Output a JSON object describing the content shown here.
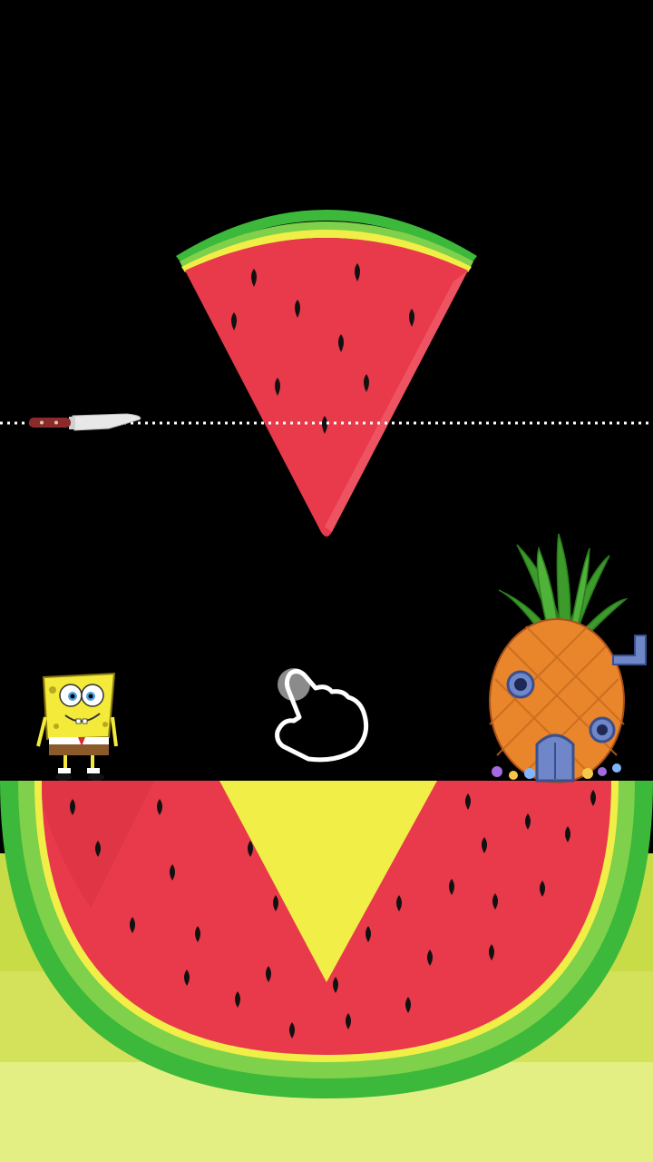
{
  "game": {
    "title": "",
    "objective_label": "",
    "colors": {
      "background": "#000000",
      "melon_flesh": "#e83a4b",
      "melon_flesh_highlight": "#ef5a66",
      "melon_rind_outer": "#3cb83a",
      "melon_rind_mid": "#7fd04a",
      "melon_rind_inner": "#f1ef47",
      "melon_seed": "#111111",
      "ground_band_1": "#c7dc46",
      "ground_band_2": "#d3e25a",
      "ground_band_3": "#e3ef82",
      "cut_line": "#ffffff",
      "knife_blade": "#e8e8e8",
      "knife_handle": "#8b2a2a",
      "pineapple_body": "#e9852a",
      "pineapple_leaves": "#3c9b2b",
      "house_window": "#6f87c8",
      "sponge_body": "#f4ea3a",
      "hand_outline": "#ffffff"
    },
    "pieces": {
      "top_slice": "watermelon-wedge",
      "bottom_slice": "watermelon-half-with-notch"
    },
    "characters": {
      "player": "spongebob",
      "goal": "pineapple-house"
    },
    "tools": {
      "cutter": "knife",
      "guide": "dotted-cut-line",
      "hint": "tap-hand-icon"
    }
  }
}
